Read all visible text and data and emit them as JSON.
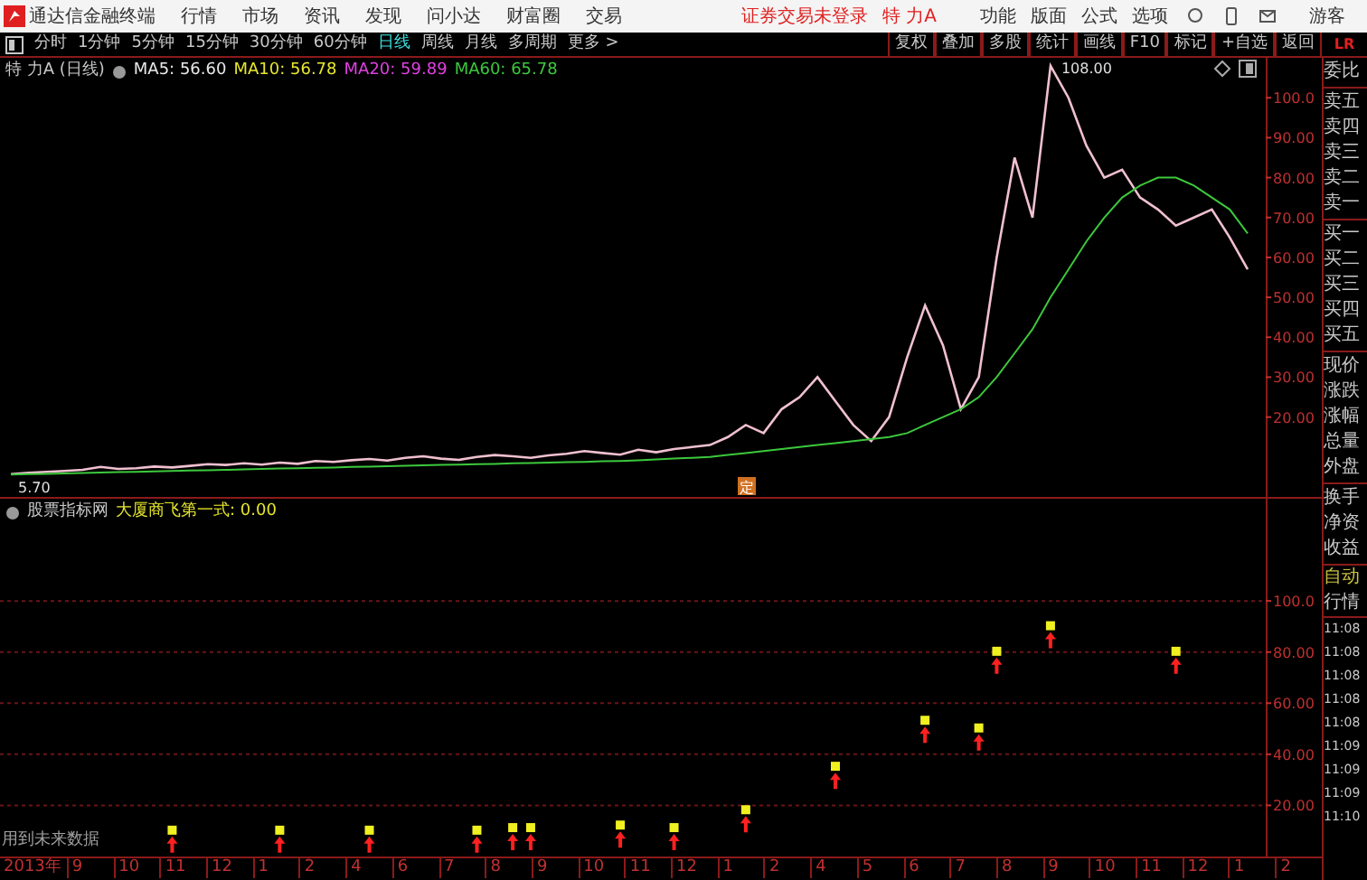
{
  "title_bar": {
    "app_name": "通达信金融终端",
    "menus": [
      "行情",
      "市场",
      "资讯",
      "发现",
      "问小达",
      "财富圈",
      "交易"
    ],
    "notice": "证券交易未登录",
    "stock": "特 力A",
    "right_menus": [
      "功能",
      "版面",
      "公式",
      "选项"
    ],
    "user": "游客"
  },
  "period_tabs": [
    {
      "label": "分时",
      "selected": false
    },
    {
      "label": "1分钟",
      "selected": false
    },
    {
      "label": "5分钟",
      "selected": false
    },
    {
      "label": "15分钟",
      "selected": false
    },
    {
      "label": "30分钟",
      "selected": false
    },
    {
      "label": "60分钟",
      "selected": false
    },
    {
      "label": "日线",
      "selected": true
    },
    {
      "label": "周线",
      "selected": false
    },
    {
      "label": "月线",
      "selected": false
    },
    {
      "label": "多周期",
      "selected": false
    },
    {
      "label": "更多 >",
      "selected": false
    }
  ],
  "tool_buttons": [
    "复权",
    "叠加",
    "多股",
    "统计",
    "画线",
    "F10",
    "标记",
    "+自选",
    "返回"
  ],
  "main_chart": {
    "legend": {
      "name": "特 力A (日线)",
      "items": [
        {
          "label": "MA5: 56.60",
          "color": "#e8e8e8"
        },
        {
          "label": "MA10: 56.78",
          "color": "#e6e62e"
        },
        {
          "label": "MA20: 59.89",
          "color": "#e040e0"
        },
        {
          "label": "MA60: 65.78",
          "color": "#3cc83c"
        }
      ]
    },
    "high_label": "108.00",
    "low_label": "5.70",
    "marker": "定",
    "chart_data": {
      "type": "line",
      "ylim": [
        0,
        110
      ],
      "categories": [
        null,
        null,
        null,
        null,
        null,
        null,
        null,
        null,
        null,
        null,
        null,
        null,
        null,
        null,
        null,
        null,
        null,
        null,
        null,
        null,
        null,
        null,
        null,
        null,
        null,
        null,
        null,
        null,
        null,
        null,
        null,
        null,
        null,
        null,
        null,
        null,
        null,
        null,
        null,
        null,
        null,
        null,
        null,
        null,
        null,
        null,
        null,
        null,
        null,
        null,
        null,
        null,
        null,
        null,
        null,
        null,
        null,
        null,
        null,
        null,
        null,
        null,
        null,
        null,
        null,
        null,
        null,
        null,
        null,
        null
      ],
      "yticks": [
        {
          "value": 100,
          "label": "100.0"
        },
        {
          "value": 90,
          "label": "90.00"
        },
        {
          "value": 80,
          "label": "80.00"
        },
        {
          "value": 70,
          "label": "70.00"
        },
        {
          "value": 60,
          "label": "60.00"
        },
        {
          "value": 50,
          "label": "50.00"
        },
        {
          "value": 40,
          "label": "40.00"
        },
        {
          "value": 30,
          "label": "30.00"
        },
        {
          "value": 20,
          "label": "20.00"
        }
      ],
      "series": [
        {
          "color": "#f0c0d0",
          "values": [
            5.7,
            6.0,
            6.3,
            6.5,
            6.8,
            7.5,
            7.0,
            7.2,
            7.6,
            7.4,
            7.8,
            8.2,
            8.0,
            8.4,
            8.1,
            8.6,
            8.3,
            9.0,
            8.8,
            9.2,
            9.5,
            9.1,
            9.8,
            10.2,
            9.6,
            9.3,
            10.0,
            10.5,
            10.2,
            9.8,
            10.4,
            10.8,
            11.5,
            11.0,
            10.6,
            11.8,
            11.2,
            12.0,
            12.5,
            13.0,
            15.0,
            18.0,
            16.0,
            22.0,
            25.0,
            30.0,
            24.0,
            18.0,
            14.0,
            20.0,
            35.0,
            48.0,
            38.0,
            22.0,
            30.0,
            60.0,
            85.0,
            70.0,
            108.0,
            100.0,
            88.0,
            80.0,
            82.0,
            75.0,
            72.0,
            68.0,
            70.0,
            72.0,
            65.0,
            57.0
          ]
        },
        {
          "color": "#3cc83c",
          "values": [
            5.6,
            5.7,
            5.8,
            5.9,
            6.0,
            6.1,
            6.2,
            6.3,
            6.4,
            6.5,
            6.6,
            6.7,
            6.8,
            6.9,
            7.0,
            7.1,
            7.2,
            7.3,
            7.4,
            7.5,
            7.6,
            7.7,
            7.8,
            7.9,
            8.0,
            8.1,
            8.2,
            8.3,
            8.4,
            8.5,
            8.6,
            8.7,
            8.8,
            8.9,
            9.0,
            9.2,
            9.4,
            9.6,
            9.8,
            10.0,
            10.5,
            11.0,
            11.5,
            12.0,
            12.5,
            13.0,
            13.5,
            14.0,
            14.5,
            15.0,
            16.0,
            18.0,
            20.0,
            22.0,
            25.0,
            30.0,
            36.0,
            42.0,
            50.0,
            57.0,
            64.0,
            70.0,
            75.0,
            78.0,
            80.0,
            80.0,
            78.0,
            75.0,
            72.0,
            66.0
          ]
        }
      ]
    }
  },
  "indicator": {
    "source": "股票指标网",
    "name": "大厦商飞第一式: 0.00",
    "note": "用到未来数据",
    "chart_data": {
      "type": "scatter",
      "grid": true,
      "ylim": [
        0,
        140
      ],
      "categories": [
        null,
        null,
        null,
        null,
        null,
        null,
        null,
        null,
        null,
        null,
        null,
        null,
        null,
        null,
        null,
        null,
        null,
        null,
        null,
        null,
        null,
        null,
        null,
        null,
        null,
        null,
        null,
        null,
        null,
        null,
        null,
        null,
        null,
        null,
        null,
        null,
        null,
        null,
        null,
        null,
        null,
        null,
        null,
        null,
        null,
        null,
        null,
        null,
        null,
        null,
        null,
        null,
        null,
        null,
        null,
        null,
        null,
        null,
        null,
        null,
        null,
        null,
        null,
        null,
        null,
        null,
        null,
        null,
        null,
        null
      ],
      "yticks": [
        {
          "value": 100,
          "label": "100.0"
        },
        {
          "value": 80,
          "label": "80.00"
        },
        {
          "value": 60,
          "label": "60.00"
        },
        {
          "value": 40,
          "label": "40.00"
        },
        {
          "value": 20,
          "label": "20.00"
        }
      ],
      "series": [
        {
          "color": "#ff2020",
          "values": [
            null,
            null,
            null,
            null,
            null,
            null,
            null,
            null,
            null,
            5,
            null,
            null,
            null,
            null,
            null,
            5,
            null,
            null,
            null,
            null,
            5,
            null,
            null,
            null,
            null,
            null,
            5,
            null,
            6,
            6,
            null,
            null,
            null,
            null,
            7,
            null,
            null,
            6,
            null,
            null,
            null,
            13,
            null,
            null,
            null,
            null,
            30,
            null,
            null,
            null,
            null,
            48,
            null,
            null,
            45,
            75,
            null,
            null,
            85,
            null,
            null,
            null,
            null,
            null,
            null,
            75,
            null,
            null,
            null,
            null
          ]
        }
      ]
    }
  },
  "time_axis": [
    "2013年",
    "9",
    "10",
    "11",
    "12",
    "1",
    "2",
    "4",
    "6",
    "7",
    "8",
    "9",
    "10",
    "11",
    "12",
    "1",
    "2",
    "4",
    "5",
    "6",
    "7",
    "8",
    "9",
    "10",
    "11",
    "12",
    "1",
    "2"
  ],
  "side_panel": {
    "header": "LR",
    "groups": [
      [
        "委比"
      ],
      [
        "卖五",
        "卖四",
        "卖三",
        "卖二",
        "卖一"
      ],
      [
        "买一",
        "买二",
        "买三",
        "买四",
        "买五"
      ],
      [
        "现价",
        "涨跌",
        "涨幅",
        "总量",
        "外盘"
      ],
      [
        "换手",
        "净资",
        "收益"
      ]
    ],
    "mode": "自动",
    "section": "行情",
    "times": [
      "11:08",
      "11:08",
      "11:08",
      "11:08",
      "11:08",
      "11:09",
      "11:09",
      "11:09",
      "11:10"
    ]
  }
}
